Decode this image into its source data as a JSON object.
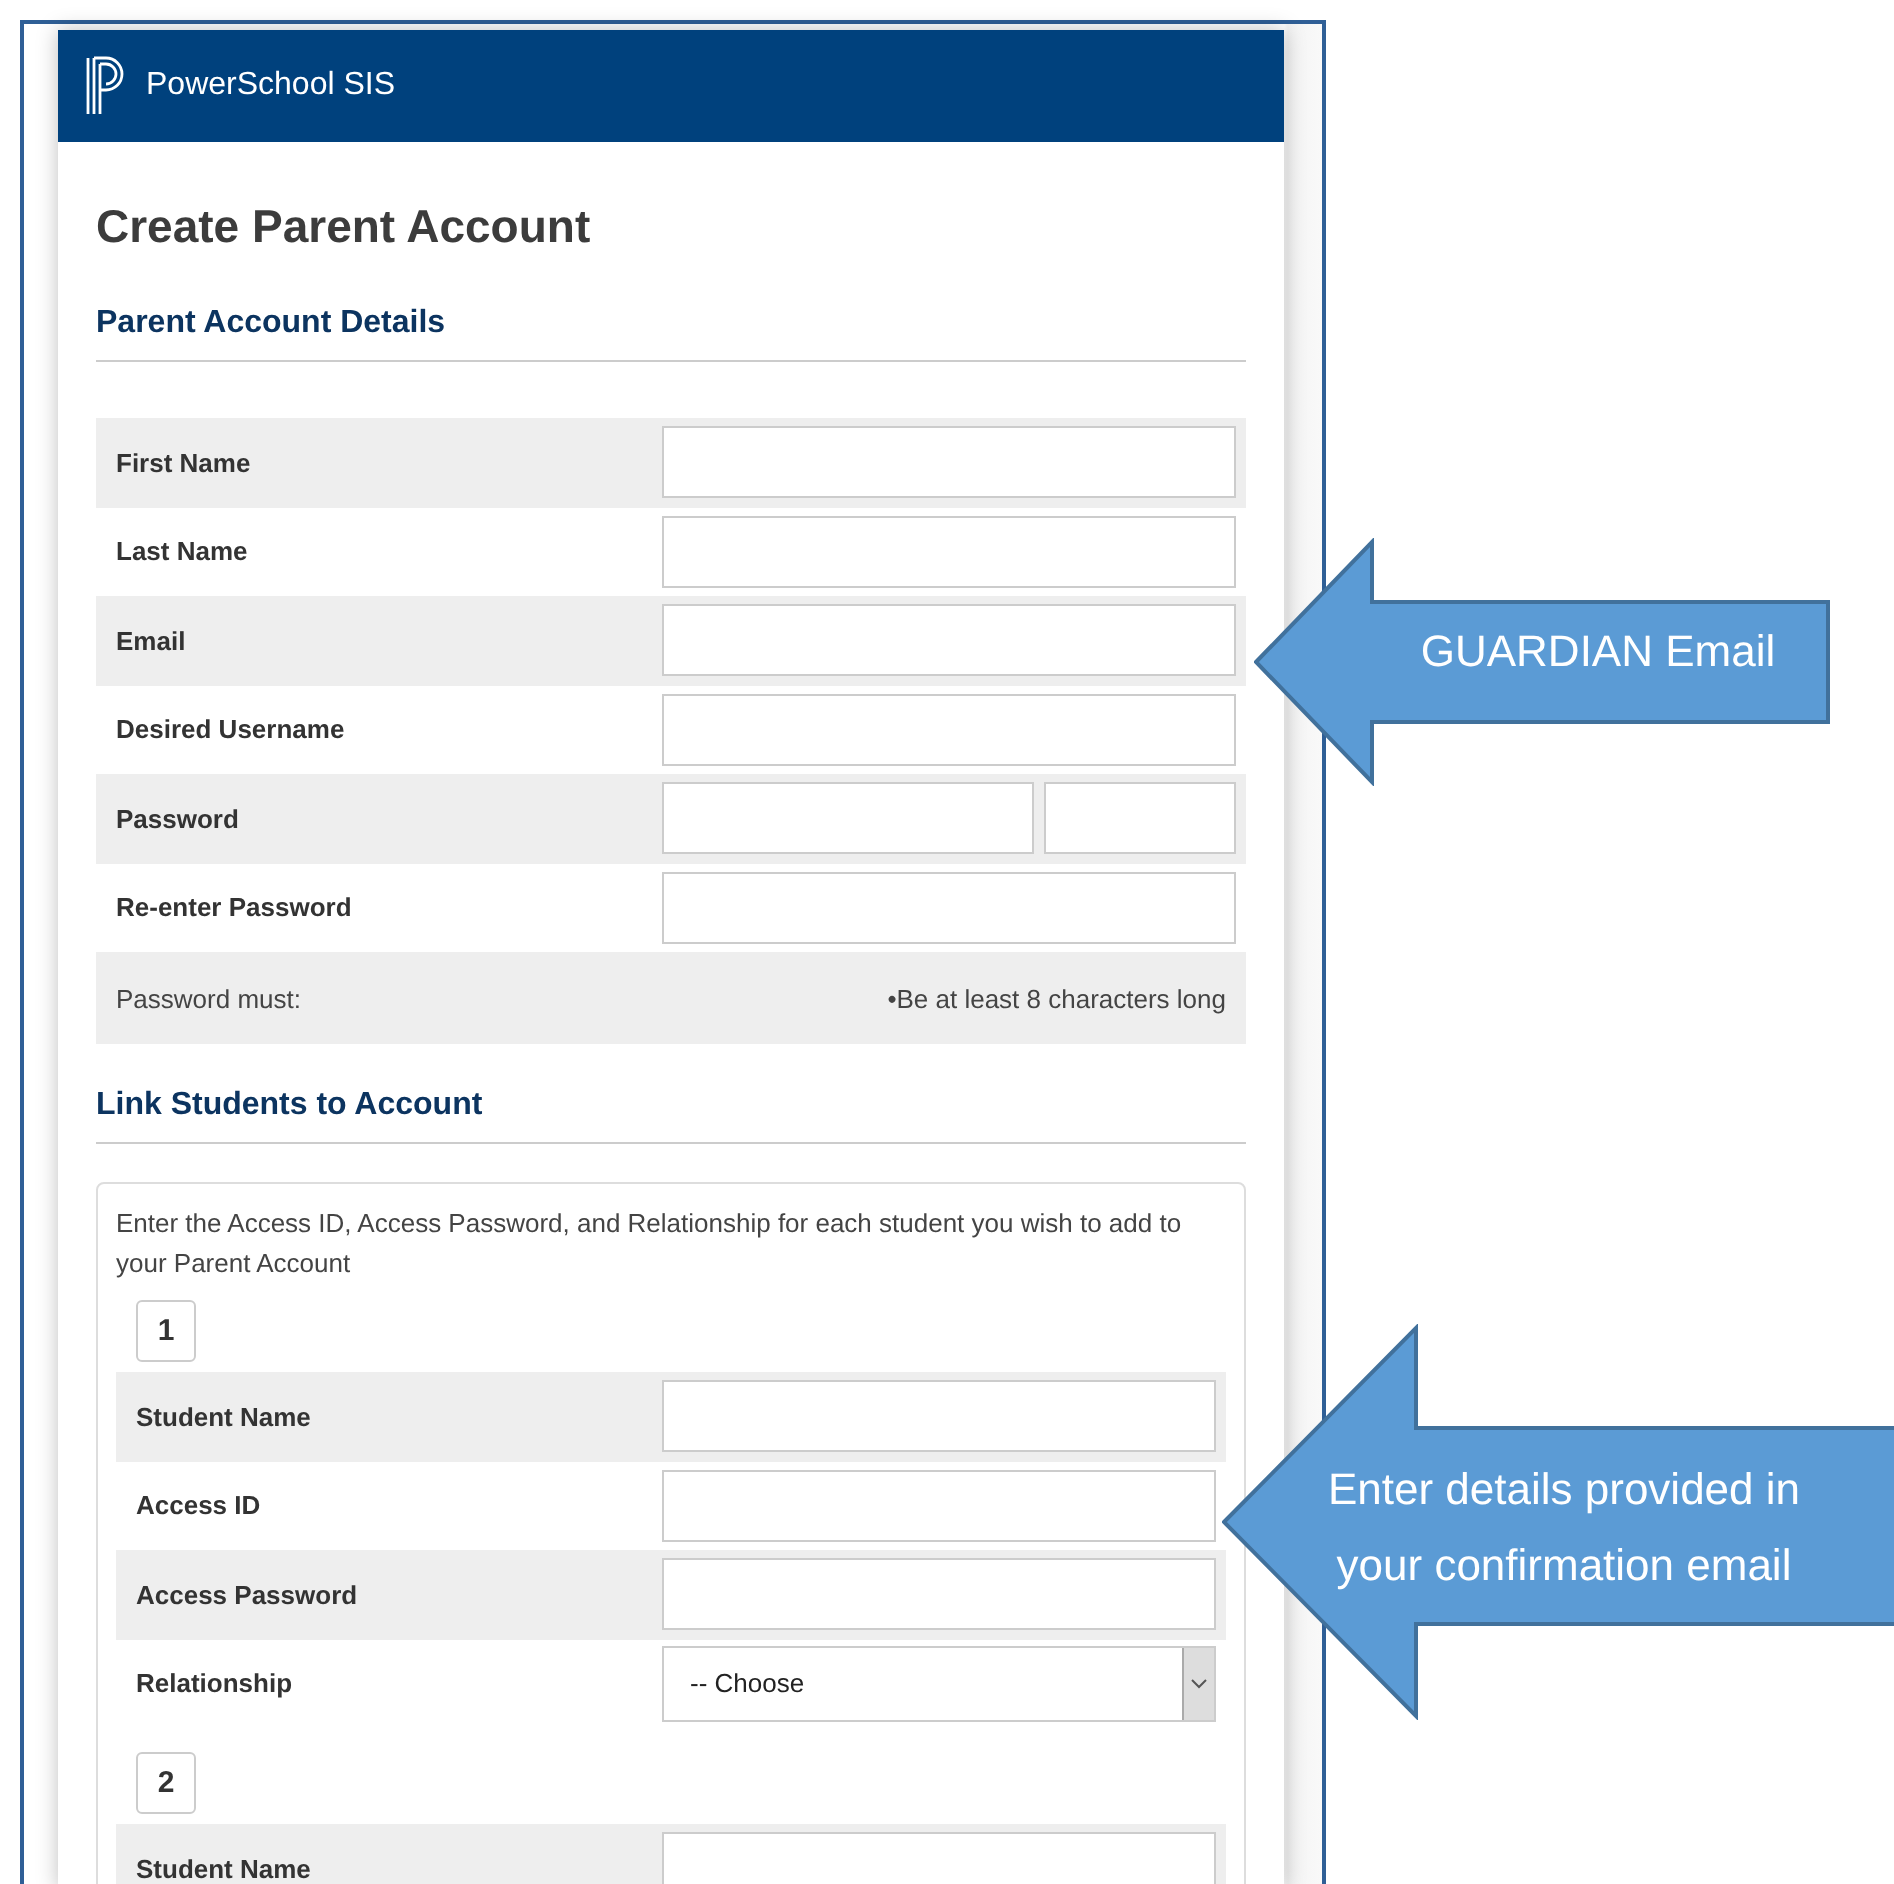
{
  "header": {
    "brand": "PowerSchool SIS"
  },
  "title": "Create Parent Account",
  "parent_details": {
    "heading": "Parent Account Details",
    "fields": [
      {
        "label": "First Name",
        "kind": "text"
      },
      {
        "label": "Last Name",
        "kind": "text"
      },
      {
        "label": "Email",
        "kind": "text"
      },
      {
        "label": "Desired Username",
        "kind": "text"
      },
      {
        "label": "Password",
        "kind": "password_pair"
      },
      {
        "label": "Re-enter Password",
        "kind": "text"
      }
    ],
    "password_rules": {
      "label": "Password must:",
      "rule": "•Be at least 8 characters long"
    }
  },
  "link_students": {
    "heading": "Link Students to Account",
    "intro": "Enter the Access ID, Access Password, and Relationship for each student you wish to add to your Parent Account",
    "students": [
      {
        "number": "1",
        "fields": [
          {
            "label": "Student Name",
            "kind": "text"
          },
          {
            "label": "Access ID",
            "kind": "text"
          },
          {
            "label": "Access Password",
            "kind": "text"
          },
          {
            "label": "Relationship",
            "kind": "select",
            "value": "-- Choose"
          }
        ]
      },
      {
        "number": "2",
        "fields": [
          {
            "label": "Student Name",
            "kind": "text"
          }
        ]
      }
    ]
  },
  "callouts": [
    {
      "text": "GUARDIAN Email"
    },
    {
      "text": "Enter details provided in your confirmation email"
    }
  ]
}
